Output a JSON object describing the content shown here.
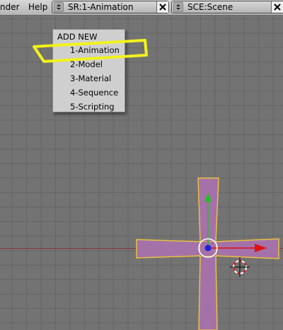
{
  "header": {
    "menu_partial": "nder",
    "help": "Help",
    "screen_field": "SR:1-Animation",
    "scene_field": "SCE:Scene"
  },
  "dropdown": {
    "title": "ADD NEW",
    "items": [
      {
        "label": "1-Animation",
        "highlighted": true
      },
      {
        "label": "2-Model"
      },
      {
        "label": "3-Material"
      },
      {
        "label": "4-Sequence"
      },
      {
        "label": "5-Scripting"
      }
    ]
  },
  "colors": {
    "viewport_bg": "#737373",
    "grid": "#666666",
    "mesh_fill": "#a472a8",
    "mesh_edge": "#e8c040",
    "highlight": "#f2f21c",
    "x_axis_arrow": "#e01010",
    "y_axis_arrow": "#20c020",
    "center_dot": "#2020e0"
  }
}
